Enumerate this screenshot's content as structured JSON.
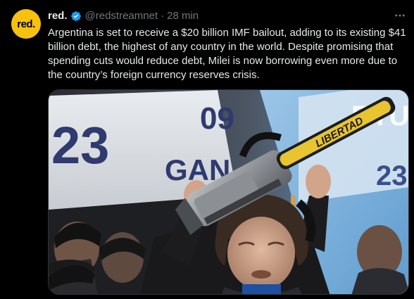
{
  "tweet": {
    "avatar_text": "red.",
    "display_name": "red.",
    "handle": "@redstreamnet",
    "separator": "·",
    "time": "28 min",
    "text": "Argentina is set to receive a $20 billion IMF bailout, adding to its existing $41 billion debt, the highest of any country in the world. Despite promising that spending cuts would reduce debt, Milei is now borrowing even more due to the country’s foreign currency reserves crisis."
  },
  "photo": {
    "banner_left_numbers": "23",
    "banner_left_word": "GAN",
    "banner_top_numbers": "09",
    "banner_right_text": "RTUD",
    "banner_right_numbers": "23",
    "chainsaw_bar_text": "LIBERTAD"
  },
  "colors": {
    "accent": "#1d9bf0",
    "avatar_bg": "#f6c20f",
    "text_primary": "#e7e9ea",
    "text_secondary": "#71767b"
  },
  "icons": {
    "verified": "verified-badge-icon",
    "more": "more-options-icon"
  }
}
